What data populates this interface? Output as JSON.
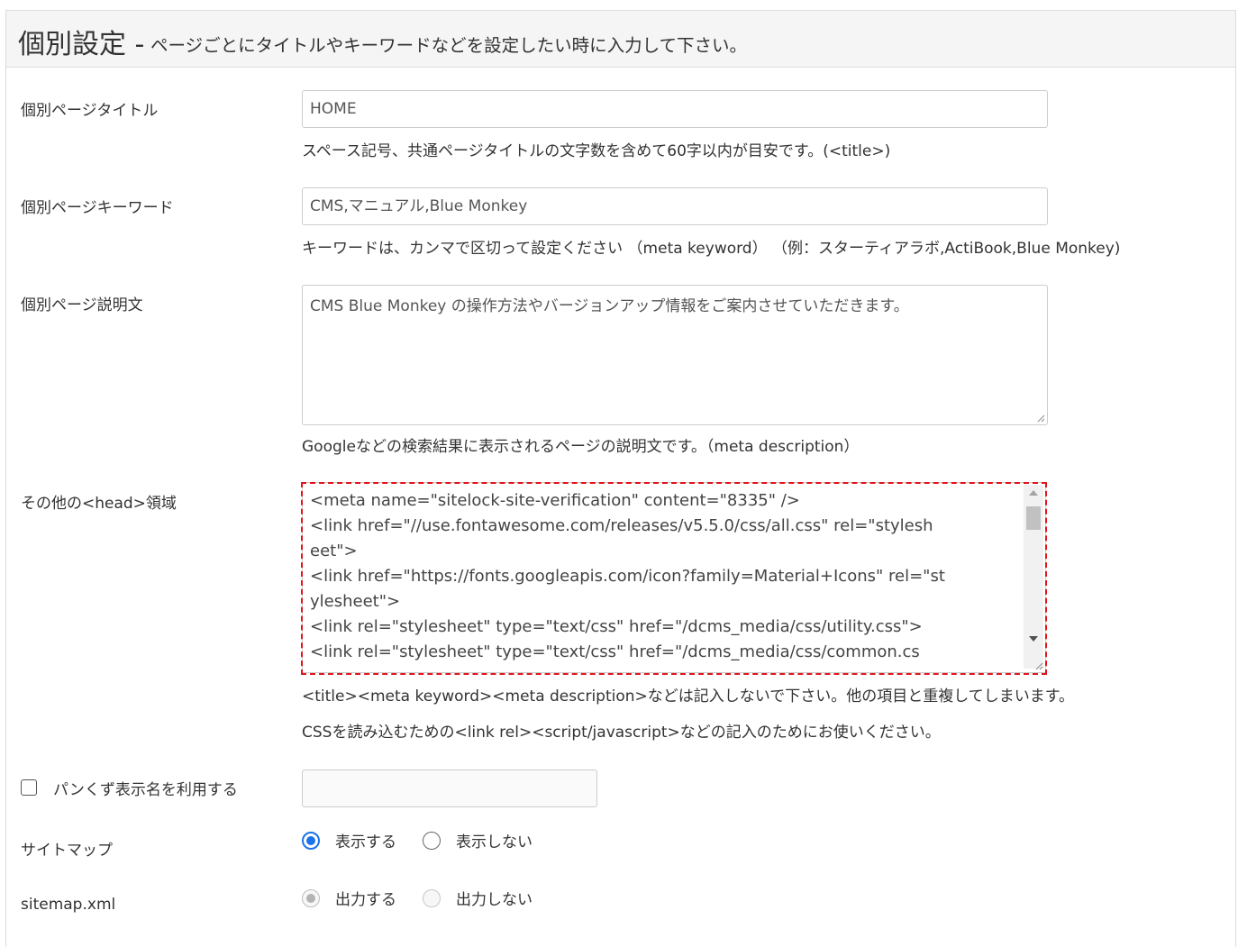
{
  "header": {
    "title": "個別設定 -",
    "subtitle": "ページごとにタイトルやキーワードなどを設定したい時に入力して下さい。"
  },
  "page_title": {
    "label": "個別ページタイトル",
    "value": "HOME",
    "help": "スペース記号、共通ページタイトルの文字数を含めて60字以内が目安です。(<title>)"
  },
  "keywords": {
    "label": "個別ページキーワード",
    "value": "CMS,マニュアル,Blue Monkey",
    "help": "キーワードは、カンマで区切って設定ください （meta keyword） （例：スターティアラボ,ActiBook,Blue Monkey)"
  },
  "description": {
    "label": "個別ページ説明文",
    "value": "CMS Blue Monkey の操作方法やバージョンアップ情報をご案内させていただきます。",
    "help": "Googleなどの検索結果に表示されるページの説明文です。（meta description）"
  },
  "head_area": {
    "label": "その他の<head>領域",
    "lines": [
      "<meta name=\"sitelock-site-verification\" content=\"8335\" />",
      "<link href=\"//use.fontawesome.com/releases/v5.5.0/css/all.css\" rel=\"stylesh",
      "eet\">",
      "<link href=\"https://fonts.googleapis.com/icon?family=Material+Icons\" rel=\"st",
      "ylesheet\">",
      "<link rel=\"stylesheet\" type=\"text/css\" href=\"/dcms_media/css/utility.css\">",
      "<link rel=\"stylesheet\" type=\"text/css\" href=\"/dcms_media/css/common.cs"
    ],
    "help1": "<title><meta keyword><meta description>などは記入しないで下さい。他の項目と重複してしまいます。",
    "help2": "CSSを読み込むための<link rel><script/javascript>などの記入のためにお使いください。"
  },
  "breadcrumb": {
    "label": "パンくず表示名を利用する",
    "checked": false,
    "value": ""
  },
  "sitemap": {
    "label": "サイトマップ",
    "option_show": "表示する",
    "option_hide": "表示しない",
    "selected": "表示する"
  },
  "sitemap_xml": {
    "label": "sitemap.xml",
    "option_output": "出力する",
    "option_no_output": "出力しない",
    "selected": "出力する",
    "disabled": true
  },
  "colors": {
    "accent": "#1a73e8",
    "highlight_border": "#e3131b"
  }
}
